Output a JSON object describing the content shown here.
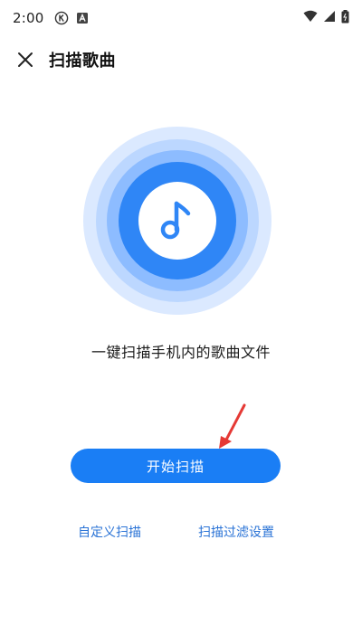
{
  "status_bar": {
    "time": "2:00"
  },
  "header": {
    "title": "扫描歌曲"
  },
  "main": {
    "icon": "music-note-icon",
    "description": "一键扫描手机内的歌曲文件",
    "start_button_label": "开始扫描",
    "custom_scan_label": "自定义扫描",
    "filter_settings_label": "扫描过滤设置"
  },
  "colors": {
    "accent": "#1a7ef5",
    "link": "#2a73d6",
    "annotation_arrow": "#e53935"
  }
}
